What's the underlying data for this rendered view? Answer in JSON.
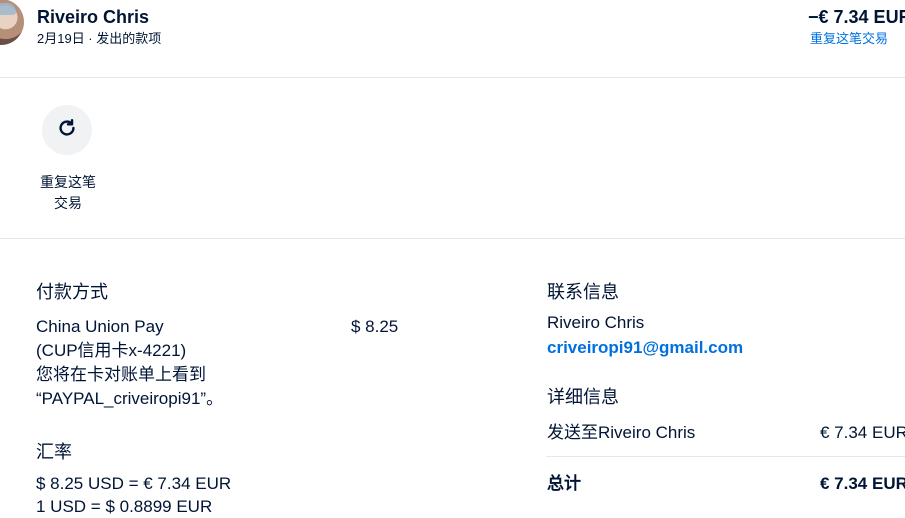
{
  "header": {
    "name": "Riveiro Chris",
    "subtitle": "2月19日 · 发出的款项",
    "amount": "−€ 7.34 EUR",
    "repeat_link": "重复这笔交易"
  },
  "actions": {
    "repeat_icon": "refresh-icon",
    "repeat_label_line1": "重复这笔",
    "repeat_label_line2": "交易"
  },
  "payment": {
    "title": "付款方式",
    "method_line1": "China Union Pay",
    "method_line2": "(CUP信用卡x-4221)",
    "method_line3": "您将在卡对账单上看到",
    "method_line4": "“PAYPAL_criveiropi91”。",
    "amount": "$ 8.25"
  },
  "exchange": {
    "title": "汇率",
    "line1": "$ 8.25 USD = € 7.34 EUR",
    "line2": "1 USD = $ 0.8899 EUR"
  },
  "contact": {
    "title": "联系信息",
    "name": "Riveiro Chris",
    "email": "criveiropi91@gmail.com"
  },
  "details": {
    "title": "详细信息",
    "sent_to_label": "发送至Riveiro Chris",
    "sent_to_amount": "€ 7.34 EUR",
    "total_label": "总计",
    "total_amount": "€ 7.34 EUR"
  },
  "colors": {
    "text": "#001435",
    "link": "#0070e0",
    "divider": "#e5e7eb",
    "icon_bg": "#f1f2f4"
  }
}
